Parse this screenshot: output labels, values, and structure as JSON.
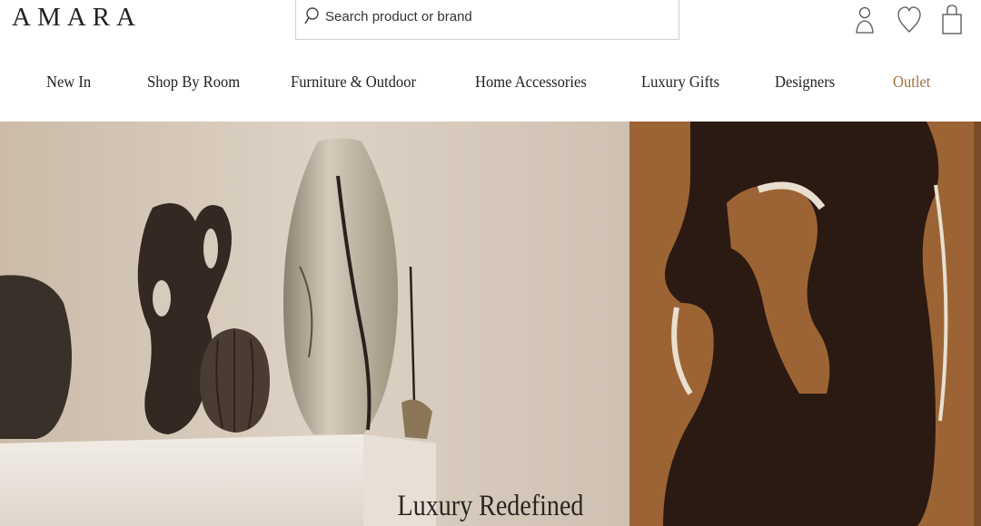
{
  "brand": {
    "logo": "AMARA"
  },
  "search": {
    "placeholder": "Search product or brand"
  },
  "header_icons": [
    "account-icon",
    "wishlist-heart-icon",
    "shopping-bag-icon"
  ],
  "nav": {
    "items": [
      {
        "label": "New In"
      },
      {
        "label": "Shop By Room"
      },
      {
        "label": "Furniture & Outdoor"
      },
      {
        "label": "Home Accessories"
      },
      {
        "label": "Luxury Gifts"
      },
      {
        "label": "Designers"
      },
      {
        "label": "Outlet"
      }
    ]
  },
  "colors": {
    "outlet": "#a0703c",
    "text": "#222222",
    "hero_wall": "#d9cdbf",
    "art_background": "#9c6434",
    "art_shape": "#2b1a12"
  },
  "hero": {
    "title": "Luxury Redefined"
  }
}
